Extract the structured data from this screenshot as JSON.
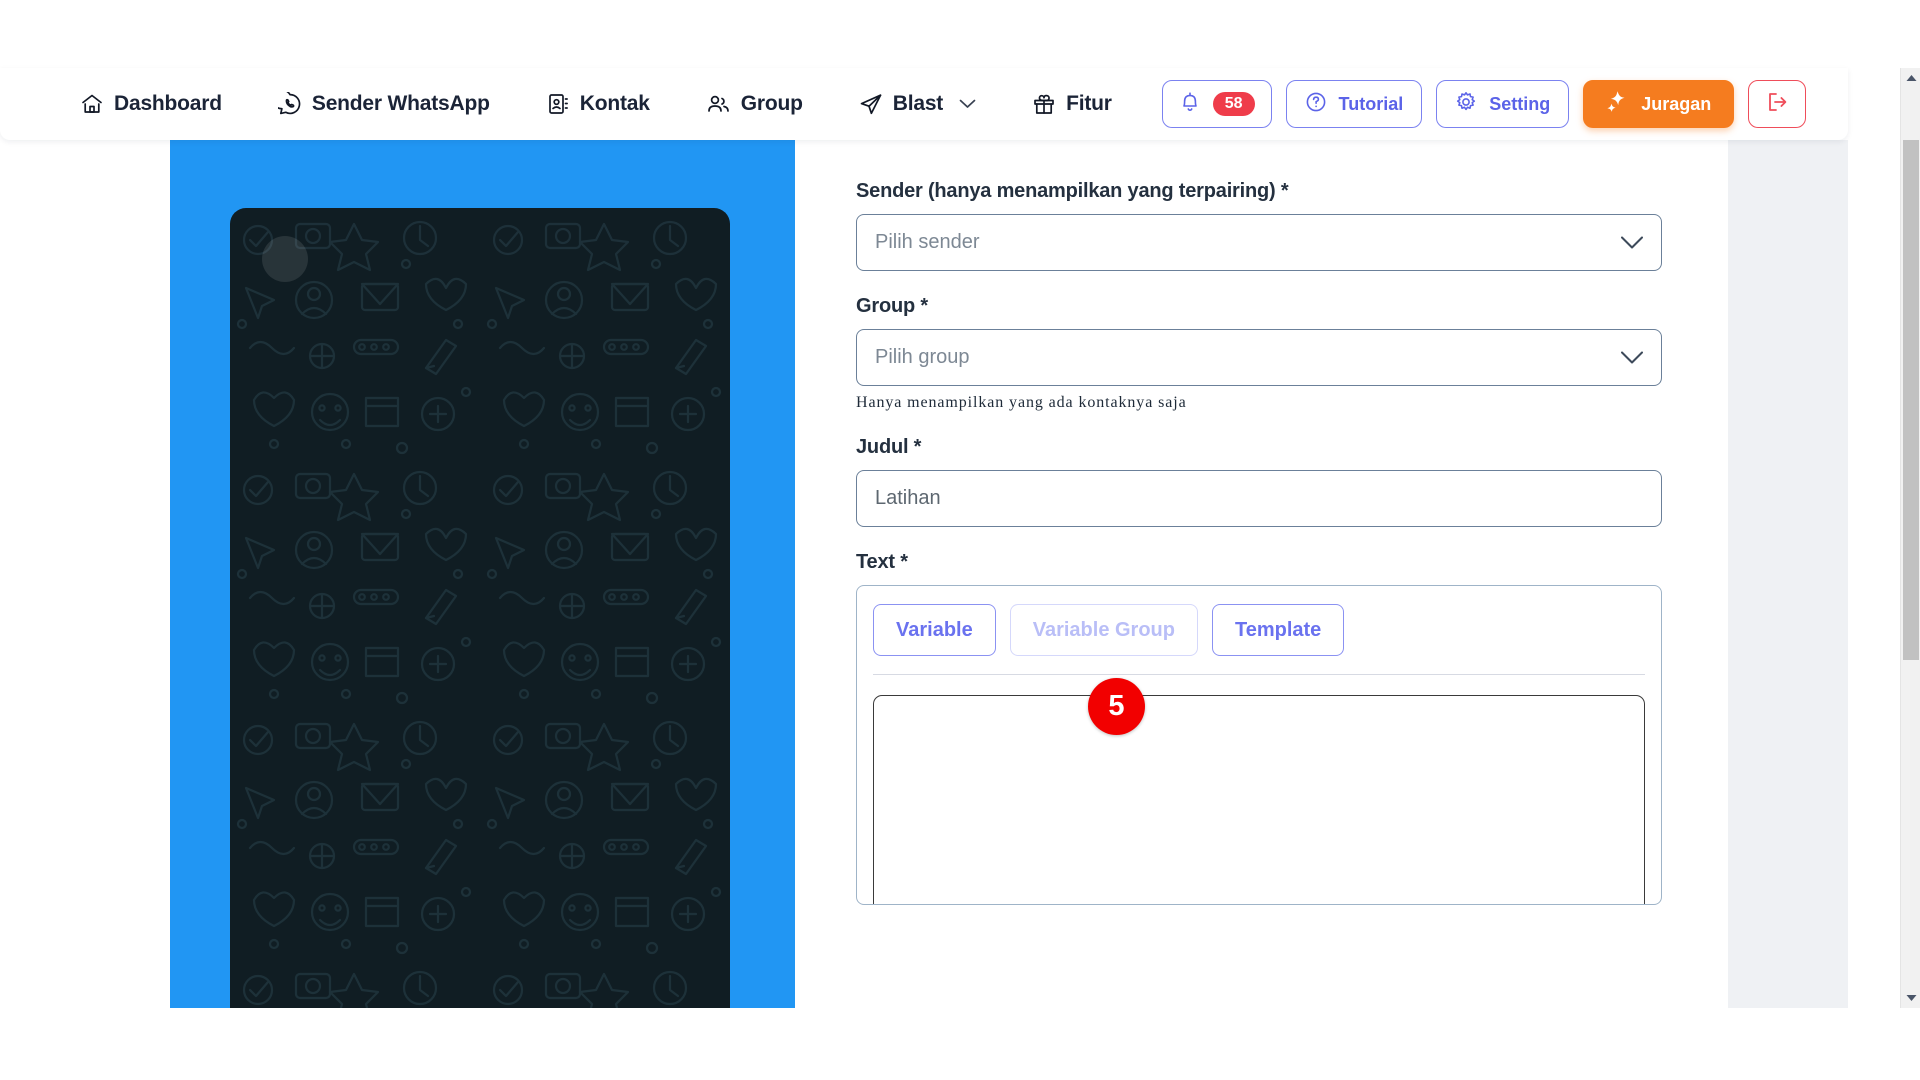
{
  "navbar": {
    "links": [
      {
        "label": "Dashboard",
        "icon": "home-icon"
      },
      {
        "label": "Sender WhatsApp",
        "icon": "whatsapp-icon"
      },
      {
        "label": "Kontak",
        "icon": "contact-book-icon"
      },
      {
        "label": "Group",
        "icon": "people-icon"
      },
      {
        "label": "Blast",
        "icon": "paper-plane-icon",
        "caret": true
      },
      {
        "label": "Fitur",
        "icon": "gift-icon"
      }
    ],
    "actions": {
      "notification_count": "58",
      "tutorial_label": "Tutorial",
      "setting_label": "Setting",
      "juragan_label": "Juragan",
      "logout_label": ""
    },
    "colors": {
      "accent_purple": "#5b63e8",
      "accent_orange": "#f57c1f",
      "accent_red": "#ef3c4a",
      "text_dark": "#1b2437"
    }
  },
  "preview": {
    "frame_color": "#2196f3",
    "chat_bg_color": "#101d23"
  },
  "form": {
    "sender": {
      "label": "Sender (hanya menampilkan yang terpairing) *",
      "placeholder": "Pilih sender",
      "value": ""
    },
    "group": {
      "label": "Group *",
      "placeholder": "Pilih group",
      "value": "",
      "helper": "Hanya menampilkan yang ada kontaknya saja"
    },
    "judul": {
      "label": "Judul *",
      "placeholder": "Latihan",
      "value": "Latihan"
    },
    "text": {
      "label": "Text *",
      "tabs": [
        {
          "label": "Variable",
          "disabled": false
        },
        {
          "label": "Variable Group",
          "disabled": true
        },
        {
          "label": "Template",
          "disabled": false
        }
      ],
      "body": ""
    }
  },
  "annotation": {
    "step_badge": "5",
    "color": "#f20000"
  },
  "scrollbar": {
    "up_arrow": "▲",
    "down_arrow": "▼"
  }
}
